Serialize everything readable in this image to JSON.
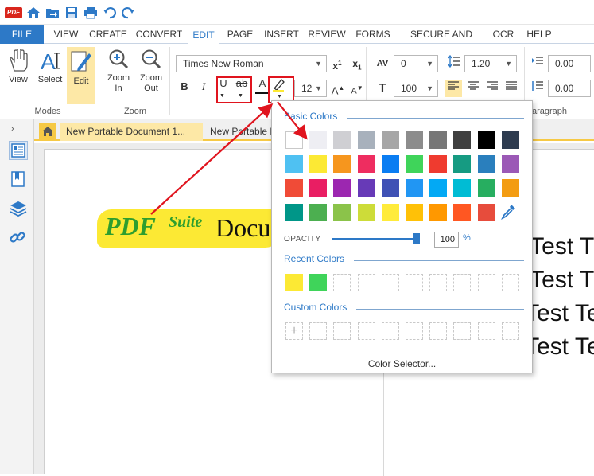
{
  "menu": {
    "tabs": [
      "FILE",
      "VIEW",
      "CREATE",
      "CONVERT",
      "EDIT",
      "PAGE",
      "INSERT",
      "REVIEW",
      "FORMS",
      "SECURE AND SIGN",
      "OCR",
      "HELP"
    ]
  },
  "titlebar": {
    "logo": "PDF"
  },
  "ribbon": {
    "modes": {
      "view": "View",
      "select": "Select",
      "edit": "Edit",
      "group": "Modes"
    },
    "zoom": {
      "zoom_in_1": "Zoom",
      "zoom_in_2": "In",
      "zoom_out_1": "Zoom",
      "zoom_out_2": "Out",
      "group": "Zoom"
    },
    "font": {
      "family": "Times New Roman",
      "size": "12",
      "bold": "B",
      "italic": "I",
      "underline": "U",
      "strike": "ab"
    },
    "char_spacing": "0",
    "scale": "100",
    "line_spacing": "1.20",
    "indent_1": "0.00",
    "indent_2": "0.00",
    "paragraph_group": "aragraph"
  },
  "doctabs": {
    "active": "New Portable Document 1...",
    "second": "New Portable D"
  },
  "document": {
    "logo_pdf": "PDF",
    "logo_suite": "Suite",
    "logo_doc": "Docu",
    "lines": [
      "t Test T",
      "t Test T",
      "Test Te",
      "Test Te"
    ]
  },
  "color_popup": {
    "basic_title": "Basic Colors",
    "recent_title": "Recent Colors",
    "custom_title": "Custom Colors",
    "opacity_label": "OPACITY",
    "opacity_value": "100",
    "opacity_fraction": 1.0,
    "opacity_unit": "%",
    "color_selector": "Color Selector...",
    "basic_colors": [
      "#ffffff",
      "#eeeef3",
      "#cfcfd3",
      "#a8b1bc",
      "#a6a6a6",
      "#8c8c8c",
      "#777777",
      "#404040",
      "#000000",
      "#2e3c50",
      "#4fc1f2",
      "#fce934",
      "#f6961e",
      "#ee2d60",
      "#0a7df2",
      "#3fd45a",
      "#ef3b2f",
      "#169b82",
      "#2a7fbd",
      "#9b59b6",
      "#f04b37",
      "#e91e63",
      "#9c27b0",
      "#673ab7",
      "#3f51b5",
      "#2196f3",
      "#03a9f4",
      "#00bcd4",
      "#27ae60",
      "#f39c12",
      "#009688",
      "#4caf50",
      "#8bc34a",
      "#cddc39",
      "#ffeb3b",
      "#ffc107",
      "#ff9800",
      "#ff5722",
      "#e74c3c"
    ],
    "recent_colors": [
      "#fce934",
      "#3fd45a"
    ]
  }
}
